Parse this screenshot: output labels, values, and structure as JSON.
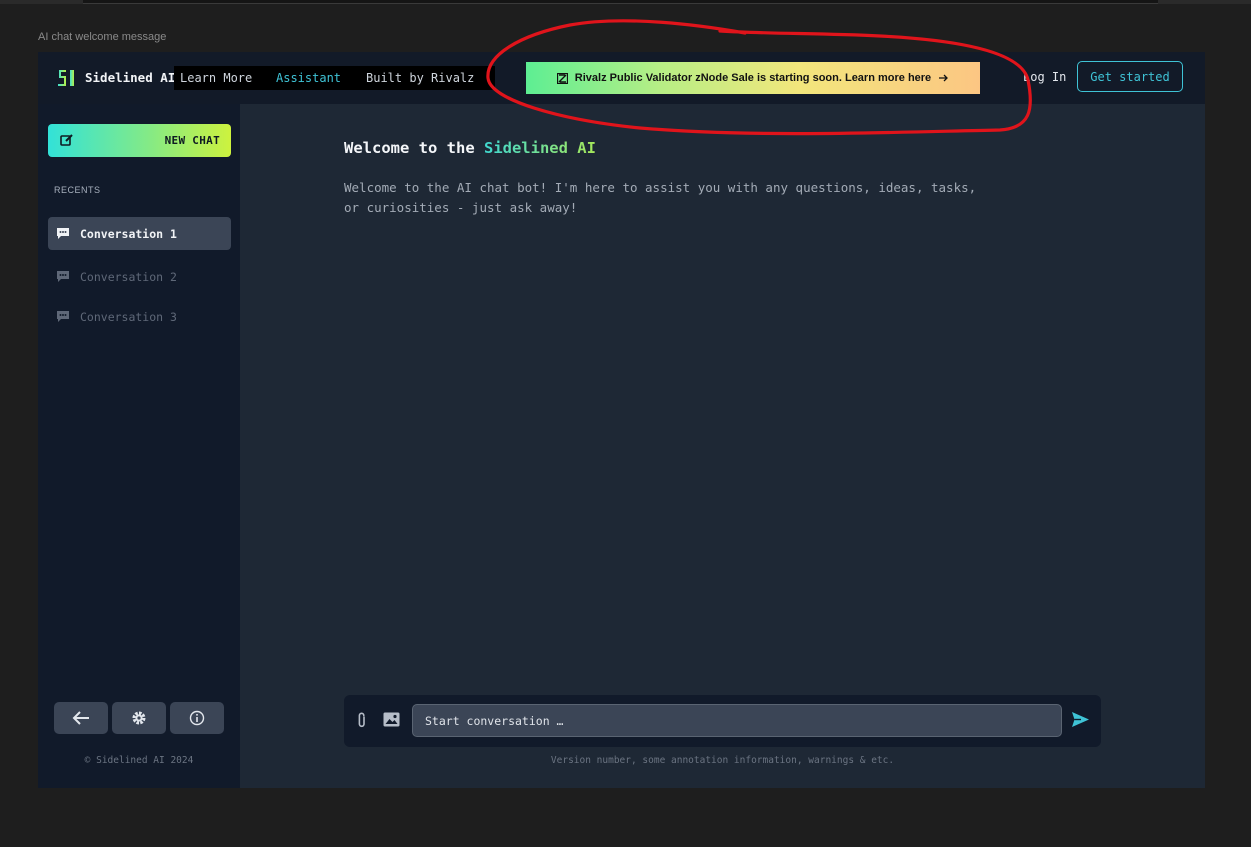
{
  "frame_label": "AI chat welcome message",
  "header": {
    "logo_text": "SI",
    "brand": "Sidelined AI",
    "nav": [
      {
        "label": "Learn More",
        "active": false
      },
      {
        "label": "Assistant",
        "active": true
      },
      {
        "label": "Built by Rivalz",
        "active": false
      }
    ],
    "promo": "Rivalz Public Validator zNode Sale is starting soon. Learn more here",
    "login": "Log In",
    "get_started": "Get started"
  },
  "sidebar": {
    "new_chat": "NEW CHAT",
    "recents_label": "RECENTS",
    "conversations": [
      {
        "label": "Conversation 1",
        "active": true
      },
      {
        "label": "Conversation 2",
        "active": false
      },
      {
        "label": "Conversation 3",
        "active": false
      }
    ],
    "bottom_icons": [
      "back-arrow-icon",
      "gear-icon",
      "info-icon"
    ],
    "copyright": "© Sidelined AI 2024"
  },
  "main": {
    "welcome_title_prefix": "Welcome to the ",
    "welcome_title_accent": "Sidelined AI",
    "welcome_text": "Welcome to the AI chat bot! I'm here to assist you with any questions, ideas, tasks, or curiosities - just ask away!",
    "input_placeholder": "Start conversation …",
    "footnote": "Version number, some annotation information, warnings & etc."
  },
  "colors": {
    "accent": "#3fc3d6",
    "promo_gradient": [
      "#5dee93",
      "#fcc683"
    ],
    "annotation": "#e0141b"
  }
}
